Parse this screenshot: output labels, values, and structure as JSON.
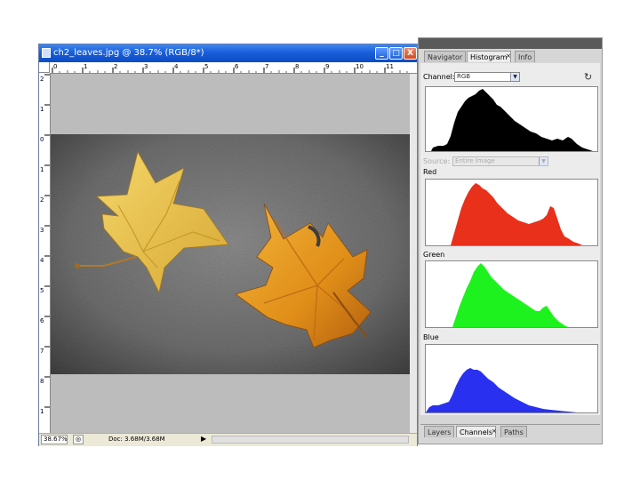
{
  "document": {
    "title": "ch2_leaves.jpg @ 38.7% (RGB/8*)",
    "ruler_top_ticks": [
      "0",
      "1",
      "2",
      "3",
      "4",
      "5",
      "6",
      "7",
      "8",
      "9",
      "10",
      "11"
    ],
    "ruler_left_ticks": [
      "2",
      "1",
      "0",
      "1",
      "2",
      "3",
      "4",
      "5",
      "6",
      "7",
      "8",
      "1"
    ],
    "zoom": "38.67%",
    "doc_info": "Doc: 3.68M/3.68M",
    "min_label": "_",
    "max_label": "□",
    "close_label": "X",
    "nav_arrow": "▶"
  },
  "panel": {
    "top_tabs": [
      "Navigator",
      "Histogram",
      "Info"
    ],
    "channel_label": "Channel:",
    "channel_value": "RGB",
    "source_label": "Source:",
    "source_value": "Entire Image",
    "channels": [
      {
        "name": "Red",
        "color": "#e8301a"
      },
      {
        "name": "Green",
        "color": "#1ef21e"
      },
      {
        "name": "Blue",
        "color": "#2a30f0"
      }
    ],
    "bottom_tabs": [
      "Layers",
      "Channels",
      "Paths"
    ],
    "refresh_icon": "↻",
    "warning_icon": "⚠"
  }
}
